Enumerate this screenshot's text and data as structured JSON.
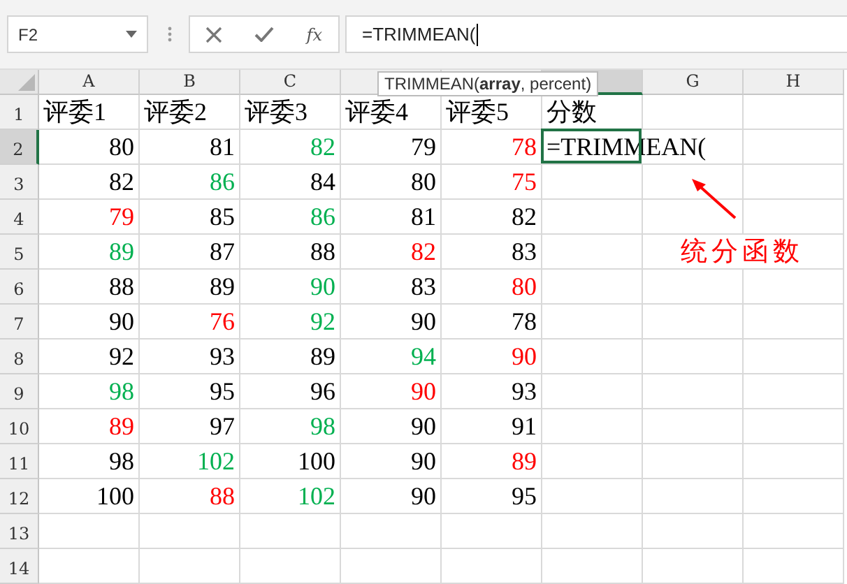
{
  "formula_bar": {
    "name_box": "F2",
    "function_button": "fx",
    "formula": "=TRIMMEAN("
  },
  "tooltip": {
    "name": "TRIMMEAN(",
    "bold_arg": "array",
    "rest": ", percent)"
  },
  "columns": [
    {
      "label": "A",
      "selected": false
    },
    {
      "label": "B",
      "selected": false
    },
    {
      "label": "C",
      "selected": false
    },
    {
      "selected": false
    },
    {
      "selected": false
    },
    {
      "selected": true
    },
    {
      "label": "G",
      "selected": false
    },
    {
      "label": "H",
      "selected": false
    }
  ],
  "rows": [
    {
      "num": "1",
      "selected": false,
      "cells": [
        {
          "text": "评委1",
          "color": "#000000",
          "selected": false
        },
        {
          "text": "评委2",
          "color": "#000000",
          "selected": false
        },
        {
          "text": "评委3",
          "color": "#000000",
          "selected": false
        },
        {
          "text": "评委4",
          "color": "#000000",
          "selected": false
        },
        {
          "text": "评委5",
          "color": "#000000",
          "selected": false
        },
        {
          "text": "分数",
          "color": "#000000",
          "selected": false
        }
      ]
    },
    {
      "num": "2",
      "selected": true,
      "cells": [
        {
          "text": "80",
          "color": "#000000",
          "selected": false
        },
        {
          "text": "81",
          "color": "#000000",
          "selected": false
        },
        {
          "text": "82",
          "color": "#00b050",
          "selected": false
        },
        {
          "text": "79",
          "color": "#000000",
          "selected": false
        },
        {
          "text": "78",
          "color": "#ff0000",
          "selected": false
        },
        {
          "text": "=TRIMMEAN(",
          "color": "#000000",
          "selected": true
        }
      ]
    },
    {
      "num": "3",
      "selected": false,
      "cells": [
        {
          "text": "82",
          "color": "#000000",
          "selected": false
        },
        {
          "text": "86",
          "color": "#00b050",
          "selected": false
        },
        {
          "text": "84",
          "color": "#000000",
          "selected": false
        },
        {
          "text": "80",
          "color": "#000000",
          "selected": false
        },
        {
          "text": "75",
          "color": "#ff0000",
          "selected": false
        }
      ]
    },
    {
      "num": "4",
      "selected": false,
      "cells": [
        {
          "text": "79",
          "color": "#ff0000",
          "selected": false
        },
        {
          "text": "85",
          "color": "#000000",
          "selected": false
        },
        {
          "text": "86",
          "color": "#00b050",
          "selected": false
        },
        {
          "text": "81",
          "color": "#000000",
          "selected": false
        },
        {
          "text": "82",
          "color": "#000000",
          "selected": false
        }
      ]
    },
    {
      "num": "5",
      "selected": false,
      "cells": [
        {
          "text": "89",
          "color": "#00b050",
          "selected": false
        },
        {
          "text": "87",
          "color": "#000000",
          "selected": false
        },
        {
          "text": "88",
          "color": "#000000",
          "selected": false
        },
        {
          "text": "82",
          "color": "#ff0000",
          "selected": false
        },
        {
          "text": "83",
          "color": "#000000",
          "selected": false
        }
      ]
    },
    {
      "num": "6",
      "selected": false,
      "cells": [
        {
          "text": "88",
          "color": "#000000",
          "selected": false
        },
        {
          "text": "89",
          "color": "#000000",
          "selected": false
        },
        {
          "text": "90",
          "color": "#00b050",
          "selected": false
        },
        {
          "text": "83",
          "color": "#000000",
          "selected": false
        },
        {
          "text": "80",
          "color": "#ff0000",
          "selected": false
        }
      ]
    },
    {
      "num": "7",
      "selected": false,
      "cells": [
        {
          "text": "90",
          "color": "#000000",
          "selected": false
        },
        {
          "text": "76",
          "color": "#ff0000",
          "selected": false
        },
        {
          "text": "92",
          "color": "#00b050",
          "selected": false
        },
        {
          "text": "90",
          "color": "#000000",
          "selected": false
        },
        {
          "text": "78",
          "color": "#000000",
          "selected": false
        }
      ]
    },
    {
      "num": "8",
      "selected": false,
      "cells": [
        {
          "text": "92",
          "color": "#000000",
          "selected": false
        },
        {
          "text": "93",
          "color": "#000000",
          "selected": false
        },
        {
          "text": "89",
          "color": "#000000",
          "selected": false
        },
        {
          "text": "94",
          "color": "#00b050",
          "selected": false
        },
        {
          "text": "90",
          "color": "#ff0000",
          "selected": false
        }
      ]
    },
    {
      "num": "9",
      "selected": false,
      "cells": [
        {
          "text": "98",
          "color": "#00b050",
          "selected": false
        },
        {
          "text": "95",
          "color": "#000000",
          "selected": false
        },
        {
          "text": "96",
          "color": "#000000",
          "selected": false
        },
        {
          "text": "90",
          "color": "#ff0000",
          "selected": false
        },
        {
          "text": "93",
          "color": "#000000",
          "selected": false
        }
      ]
    },
    {
      "num": "10",
      "selected": false,
      "cells": [
        {
          "text": "89",
          "color": "#ff0000",
          "selected": false
        },
        {
          "text": "97",
          "color": "#000000",
          "selected": false
        },
        {
          "text": "98",
          "color": "#00b050",
          "selected": false
        },
        {
          "text": "90",
          "color": "#000000",
          "selected": false
        },
        {
          "text": "91",
          "color": "#000000",
          "selected": false
        }
      ]
    },
    {
      "num": "11",
      "selected": false,
      "cells": [
        {
          "text": "98",
          "color": "#000000",
          "selected": false
        },
        {
          "text": "102",
          "color": "#00b050",
          "selected": false
        },
        {
          "text": "100",
          "color": "#000000",
          "selected": false
        },
        {
          "text": "90",
          "color": "#000000",
          "selected": false
        },
        {
          "text": "89",
          "color": "#ff0000",
          "selected": false
        }
      ]
    },
    {
      "num": "12",
      "selected": false,
      "cells": [
        {
          "text": "100",
          "color": "#000000",
          "selected": false
        },
        {
          "text": "88",
          "color": "#ff0000",
          "selected": false
        },
        {
          "text": "102",
          "color": "#00b050",
          "selected": false
        },
        {
          "text": "90",
          "color": "#000000",
          "selected": false
        },
        {
          "text": "95",
          "color": "#000000",
          "selected": false
        }
      ]
    },
    {
      "num": "13",
      "selected": false,
      "cells": []
    },
    {
      "num": "14",
      "selected": false,
      "cells": []
    }
  ],
  "annotation": {
    "text": "统分函数"
  }
}
